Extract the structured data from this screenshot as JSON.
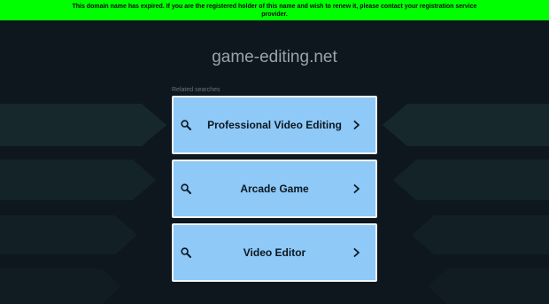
{
  "banner": {
    "line1": "This domain name has expired. If you are the registered holder of this name and wish to renew it, please contact your registration service",
    "line2": "provider."
  },
  "domain_title": "game-editing.net",
  "related_label": "Related searches",
  "searches": [
    {
      "label": "Professional Video Editing",
      "icon": "search-icon",
      "chevron": "chevron-right-icon"
    },
    {
      "label": "Arcade Game",
      "icon": "search-icon",
      "chevron": "chevron-right-icon"
    },
    {
      "label": "Video Editor",
      "icon": "search-icon",
      "chevron": "chevron-right-icon"
    }
  ],
  "colors": {
    "banner_bg": "#00ff00",
    "page_bg": "#0e171d",
    "card_bg": "#8ec9f7",
    "card_border": "#f2f5f7"
  }
}
